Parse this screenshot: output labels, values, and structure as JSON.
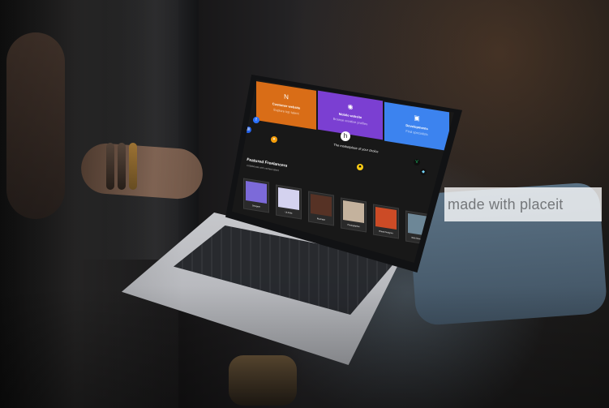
{
  "screen": {
    "choice_cards": [
      {
        "icon": "N",
        "title": "Customer website",
        "subtitle": "Explore top talent"
      },
      {
        "icon": "◉",
        "title": "Mobile website",
        "subtitle": "Browse creative profiles"
      },
      {
        "icon": "▣",
        "title": "Developments",
        "subtitle": "Find specialists"
      }
    ],
    "logo_text": "h",
    "headline": "The marketplace of your choice",
    "section_title": "Featured Freelancers",
    "section_subtitle": "Collaborate with verified talent",
    "icons": [
      {
        "name": "wordpress-icon",
        "symbol": "W"
      },
      {
        "name": "facebook-icon",
        "symbol": "f"
      },
      {
        "name": "spark-icon",
        "symbol": "✦"
      },
      {
        "name": "star-icon",
        "symbol": "✸"
      },
      {
        "name": "vue-icon",
        "symbol": "V"
      },
      {
        "name": "python-icon",
        "symbol": "◆"
      }
    ],
    "freelancers": [
      {
        "name": "Designer",
        "photo_color": "#7c6ad9"
      },
      {
        "name": "UI Artist",
        "photo_color": "#d4d2ef"
      },
      {
        "name": "Illustrator",
        "photo_color": "#563225"
      },
      {
        "name": "Photographer",
        "photo_color": "#c4b29d"
      },
      {
        "name": "Brand Designer",
        "photo_color": "#cc4b26"
      },
      {
        "name": "Web Developer",
        "photo_color": "#6d8797"
      }
    ]
  },
  "watermark": {
    "text": "made with placeit"
  },
  "colors": {
    "orange": "#d96d17",
    "purple": "#7b3fd2",
    "blue": "#3c83ef"
  }
}
